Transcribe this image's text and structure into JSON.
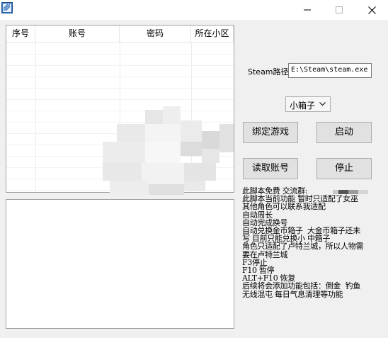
{
  "window": {
    "title": ""
  },
  "grid": {
    "columns": [
      "序号",
      "账号",
      "密码",
      "所在小区"
    ],
    "rows": []
  },
  "steam": {
    "label": "Steam路径",
    "value": "E:\\Steam\\steam.exe"
  },
  "box_select": {
    "selected": "小箱子"
  },
  "buttons": {
    "bind": "绑定游戏",
    "start": "启动",
    "read": "读取账号",
    "stop": "停止"
  },
  "notes": [
    "此脚本免费 交流群:",
    "此脚本当前功能 暂时只适配了女巫",
    "其他角色可以联系我适配",
    "自动周长",
    "自动完成换号",
    "自动兑换金币箱子  大金币箱子还未",
    "写 目前只能兑换小 中箱子",
    "角色只适配了卢特兰城，所以人物需",
    "要在卢特兰城",
    "F3停止",
    "F10 暂停",
    "ALT+F10 恢复",
    "后续将会添加功能包括：倒金  钓鱼",
    "无线混屯 每日气息清理等功能"
  ]
}
